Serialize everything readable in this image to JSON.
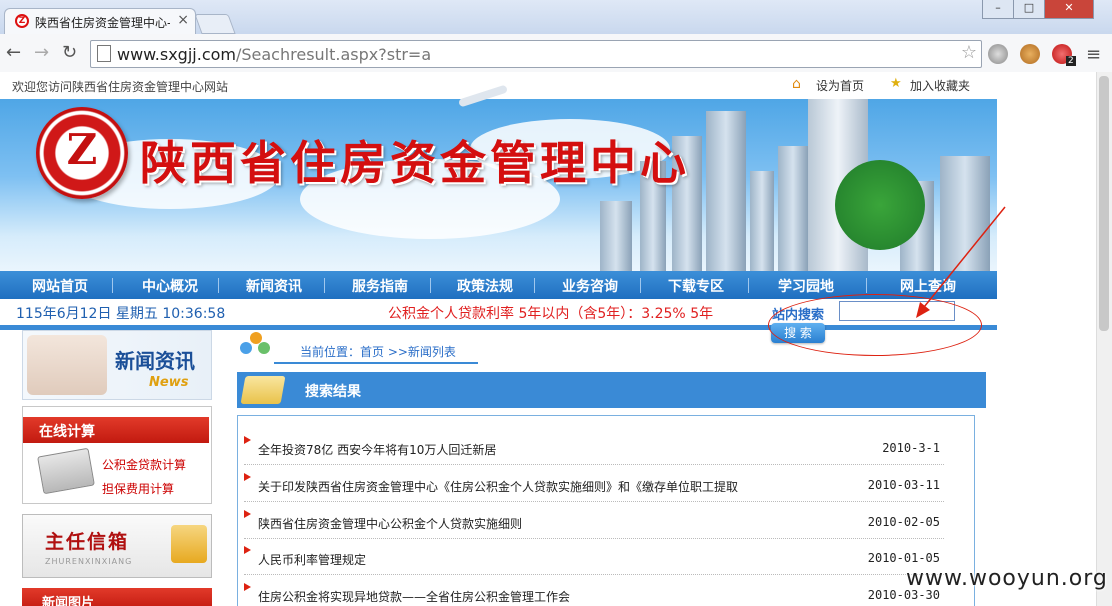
{
  "browser": {
    "tab_title": "陕西省住房资金管理中心-",
    "tab_favicon": "Z",
    "url_host": "www.sxgjj.com",
    "url_path": "/Seachresult.aspx?str=a",
    "extension_badge": "2"
  },
  "topbar": {
    "welcome": "欢迎您访问陕西省住房资金管理中心网站",
    "set_home": "设为首页",
    "add_favorite": "加入收藏夹"
  },
  "banner": {
    "logo_letter": "Z",
    "site_title": "陕西省住房资金管理中心"
  },
  "nav": {
    "items": [
      "网站首页",
      "中心概况",
      "新闻资讯",
      "服务指南",
      "政策法规",
      "业务咨询",
      "下载专区",
      "学习园地",
      "网上查询"
    ]
  },
  "infobar": {
    "datetime": "115年6月12日 星期五 10:36:58",
    "ticker": "公积金个人贷款利率  5年以内（含5年）：3.25%  5年",
    "search_label": "站内搜索",
    "search_value": "",
    "search_button": "搜 索"
  },
  "sidebar": {
    "news_title": "新闻资讯",
    "news_subtitle": "News",
    "calc_title": "在线计算",
    "calc_links": [
      "公积金贷款计算",
      "担保费用计算"
    ],
    "mailbox_title": "主任信箱",
    "mailbox_subtitle": "ZHURENXINXIANG",
    "news_pics_title": "新闻图片"
  },
  "main": {
    "breadcrumb": "当前位置：首页 >>新闻列表",
    "results_title": "搜索结果",
    "results": [
      {
        "title": "全年投资78亿 西安今年将有10万人回迁新居",
        "date": "2010-3-1"
      },
      {
        "title": "关于印发陕西省住房资金管理中心《住房公积金个人贷款实施细则》和《缴存单位职工提取",
        "date": "2010-03-11"
      },
      {
        "title": "陕西省住房资金管理中心公积金个人贷款实施细则",
        "date": "2010-02-05"
      },
      {
        "title": "人民币利率管理规定",
        "date": "2010-01-05"
      },
      {
        "title": "住房公积金将实现异地贷款——全省住房公积金管理工作会",
        "date": "2010-03-30"
      }
    ]
  },
  "watermark": "www.wooyun.org",
  "colors": {
    "nav_blue": "#1f6fc0",
    "accent_red": "#d40f0f",
    "link_blue": "#2a6ec8"
  }
}
